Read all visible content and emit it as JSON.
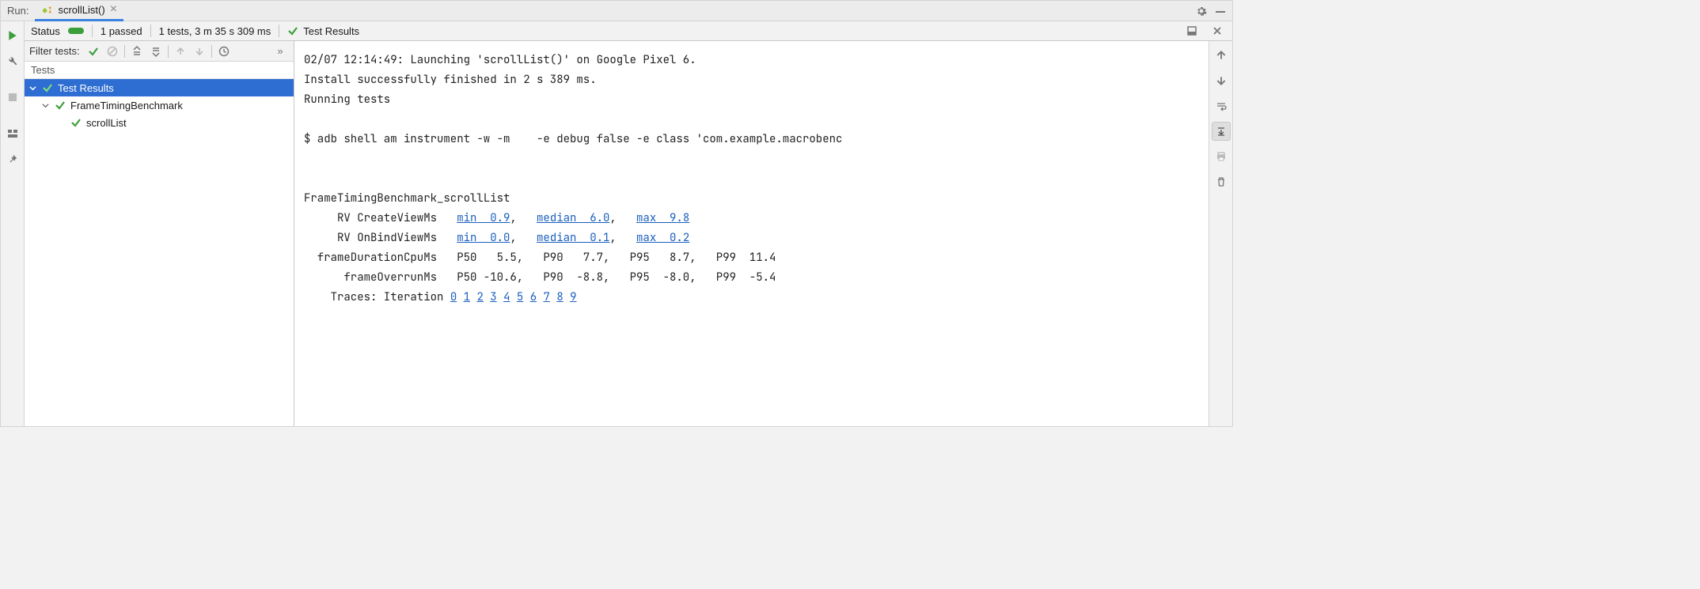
{
  "header": {
    "run_label": "Run:",
    "tab_name": "scrollList()"
  },
  "status": {
    "status_label": "Status",
    "passed": "1 passed",
    "summary": "1 tests, 3 m 35 s 309 ms",
    "crumb": "Test Results"
  },
  "filter": {
    "label": "Filter tests:"
  },
  "tree": {
    "header": "Tests",
    "root": "Test Results",
    "suite": "FrameTimingBenchmark",
    "test": "scrollList"
  },
  "console": {
    "line1": "02/07 12:14:49: Launching 'scrollList()' on Google Pixel 6.",
    "line2": "Install successfully finished in 2 s 389 ms.",
    "line3": "Running tests",
    "cmd": "$ adb shell am instrument -w -m    -e debug false -e class 'com.example.macrobenc",
    "bench_title": "FrameTimingBenchmark_scrollList",
    "row1_label": "RV CreateViewMs",
    "row1_min": "min  0.9",
    "row1_med": "median  6.0",
    "row1_max": "max  9.8",
    "row2_label": "RV OnBindViewMs",
    "row2_min": "min  0.0",
    "row2_med": "median  0.1",
    "row2_max": "max  0.2",
    "row3": "  frameDurationCpuMs   P50   5.5,   P90   7.7,   P95   8.7,   P99  11.4",
    "row4": "      frameOverrunMs   P50 -10.6,   P90  -8.8,   P95  -8.0,   P99  -5.4",
    "traces_label": "    Traces: Iteration ",
    "iterations": [
      "0",
      "1",
      "2",
      "3",
      "4",
      "5",
      "6",
      "7",
      "8",
      "9"
    ]
  },
  "chart_data": {
    "type": "table",
    "title": "FrameTimingBenchmark_scrollList",
    "series": [
      {
        "name": "RV CreateViewMs",
        "min": 0.9,
        "median": 6.0,
        "max": 9.8
      },
      {
        "name": "RV OnBindViewMs",
        "min": 0.0,
        "median": 0.1,
        "max": 0.2
      },
      {
        "name": "frameDurationCpuMs",
        "P50": 5.5,
        "P90": 7.7,
        "P95": 8.7,
        "P99": 11.4
      },
      {
        "name": "frameOverrunMs",
        "P50": -10.6,
        "P90": -8.8,
        "P95": -8.0,
        "P99": -5.4
      }
    ]
  }
}
